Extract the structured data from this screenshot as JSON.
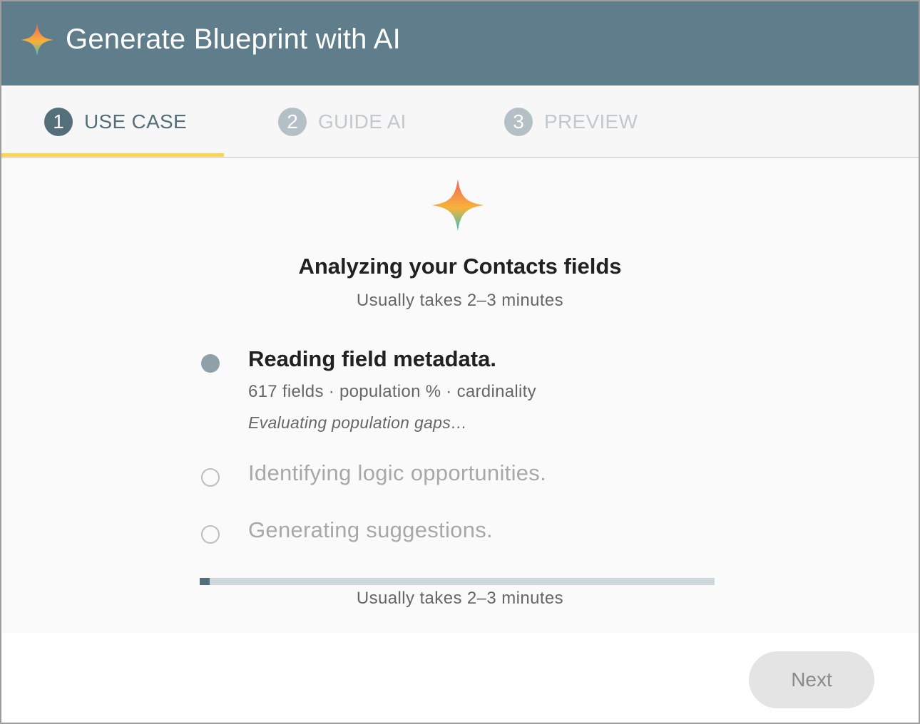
{
  "header": {
    "title": "Generate Blueprint with AI",
    "icon": "sparkle-icon"
  },
  "tabs": [
    {
      "number": "1",
      "label": "USE CASE",
      "state": "active"
    },
    {
      "number": "2",
      "label": "GUIDE AI",
      "state": "inactive"
    },
    {
      "number": "3",
      "label": "PREVIEW",
      "state": "inactive"
    }
  ],
  "analysis": {
    "icon": "sparkle-icon",
    "title": "Analyzing your Contacts fields",
    "subtitle": "Usually takes 2–3 minutes",
    "steps": [
      {
        "title": "Reading field metadata.",
        "detail": "617 fields · population % · cardinality",
        "status": "Evaluating population gaps…",
        "state": "in-progress"
      },
      {
        "title": "Identifying logic opportunities.",
        "state": "pending"
      },
      {
        "title": "Generating suggestions.",
        "state": "pending"
      }
    ],
    "progress": {
      "percent": 2,
      "note": "Usually takes 2–3 minutes"
    }
  },
  "footer": {
    "next_label": "Next",
    "next_enabled": false
  },
  "colors": {
    "header_bg": "#5f7d8a",
    "accent": "#546e7a",
    "tab_underline": "#ffd54f",
    "progress_track": "#cfd8dc"
  }
}
